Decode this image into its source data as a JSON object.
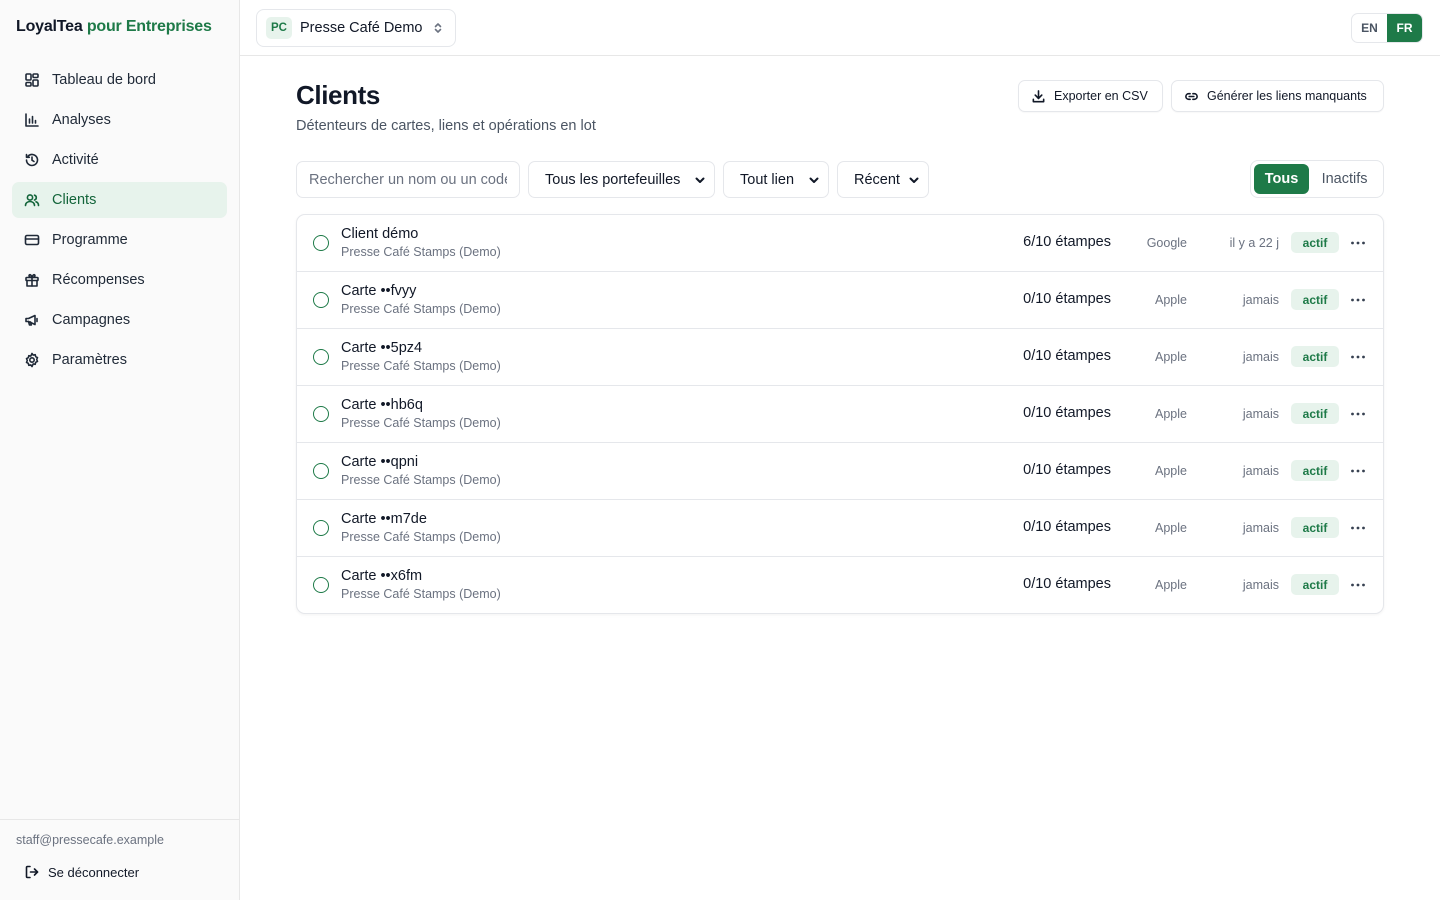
{
  "sidebar": {
    "brand_name": "LoyalTea",
    "brand_accent": "pour Entreprises",
    "items": [
      {
        "label": "Tableau de bord",
        "icon": "dashboard-icon"
      },
      {
        "label": "Analyses",
        "icon": "bar-chart-icon"
      },
      {
        "label": "Activité",
        "icon": "history-icon"
      },
      {
        "label": "Clients",
        "icon": "users-icon",
        "active": true
      },
      {
        "label": "Programme",
        "icon": "card-icon"
      },
      {
        "label": "Récompenses",
        "icon": "gift-icon"
      },
      {
        "label": "Campagnes",
        "icon": "megaphone-icon"
      },
      {
        "label": "Paramètres",
        "icon": "gear-icon"
      }
    ],
    "user_email": "staff@pressecafe.example",
    "logout_label": "Se déconnecter"
  },
  "topbar": {
    "org_initials": "PC",
    "org_name": "Presse Café Demo",
    "lang_en": "EN",
    "lang_fr": "FR",
    "active_lang": "FR"
  },
  "page": {
    "title": "Clients",
    "subtitle": "Détenteurs de cartes, liens et opérations en lot",
    "export_label": "Exporter en CSV",
    "generate_label": "Générer les liens manquants"
  },
  "filters": {
    "search_placeholder": "Rechercher un nom ou un code",
    "wallet_select": "Tous les portefeuilles",
    "link_select": "Tout lien",
    "sort_select": "Récent",
    "seg_all": "Tous",
    "seg_inactive": "Inactifs"
  },
  "rows": [
    {
      "name": "Client démo",
      "program": "Presse Café Stamps (Demo)",
      "stamps": "6/10 étampes",
      "wallet": "Google",
      "last": "il y a 22 j",
      "status": "actif"
    },
    {
      "name": "Carte ••fvyy",
      "program": "Presse Café Stamps (Demo)",
      "stamps": "0/10 étampes",
      "wallet": "Apple",
      "last": "jamais",
      "status": "actif"
    },
    {
      "name": "Carte ••5pz4",
      "program": "Presse Café Stamps (Demo)",
      "stamps": "0/10 étampes",
      "wallet": "Apple",
      "last": "jamais",
      "status": "actif"
    },
    {
      "name": "Carte ••hb6q",
      "program": "Presse Café Stamps (Demo)",
      "stamps": "0/10 étampes",
      "wallet": "Apple",
      "last": "jamais",
      "status": "actif"
    },
    {
      "name": "Carte ••qpni",
      "program": "Presse Café Stamps (Demo)",
      "stamps": "0/10 étampes",
      "wallet": "Apple",
      "last": "jamais",
      "status": "actif"
    },
    {
      "name": "Carte ••m7de",
      "program": "Presse Café Stamps (Demo)",
      "stamps": "0/10 étampes",
      "wallet": "Apple",
      "last": "jamais",
      "status": "actif"
    },
    {
      "name": "Carte ••x6fm",
      "program": "Presse Café Stamps (Demo)",
      "stamps": "0/10 étampes",
      "wallet": "Apple",
      "last": "jamais",
      "status": "actif"
    }
  ],
  "colors": {
    "accent": "#1e7a48",
    "accent_soft": "#e7f3ec",
    "sidebar_bg": "#fafafa",
    "border": "#e5e7eb"
  }
}
